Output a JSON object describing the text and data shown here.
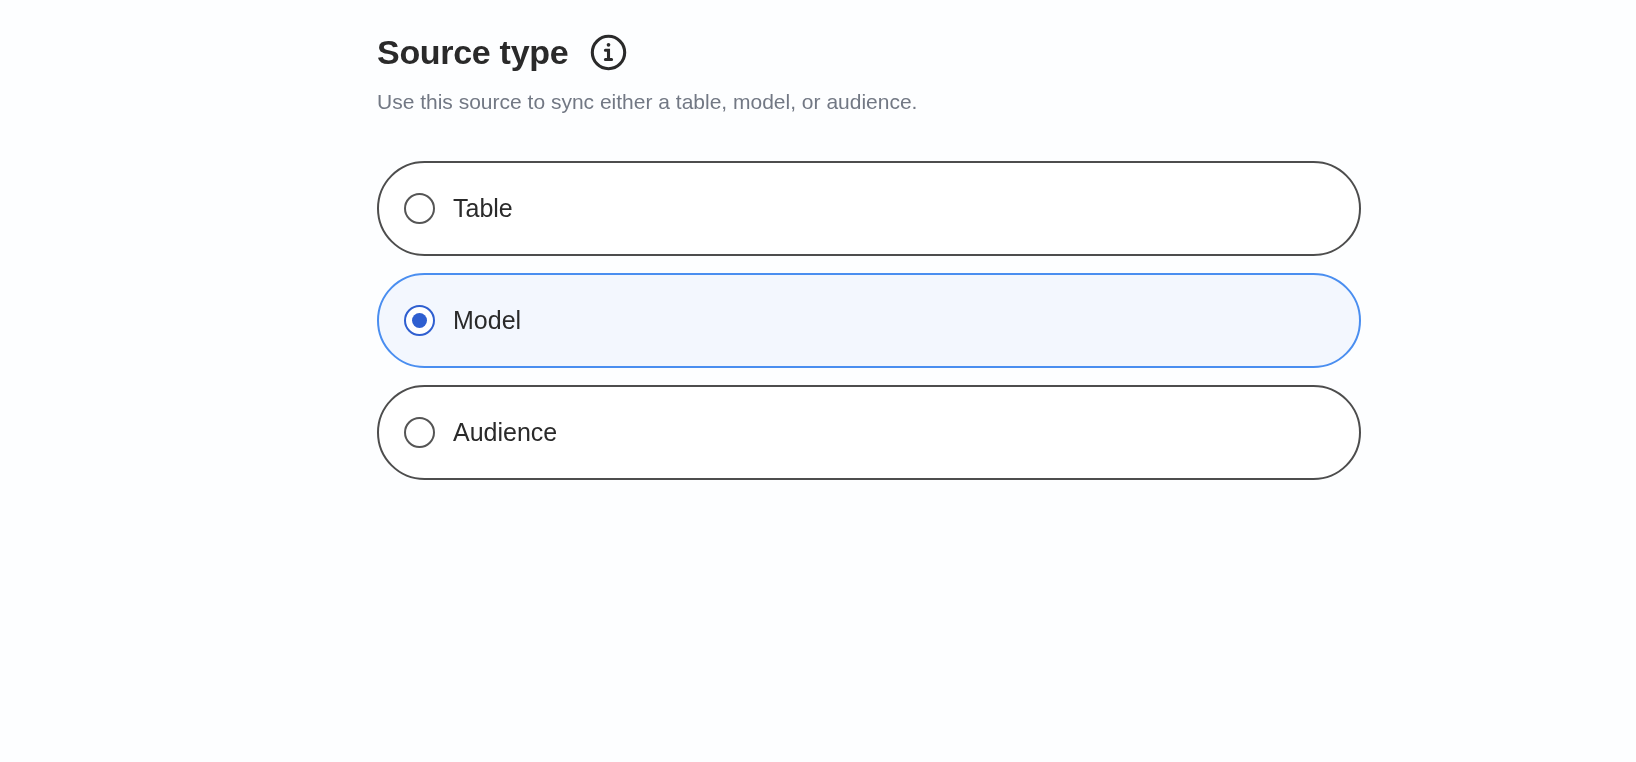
{
  "section": {
    "title": "Source type",
    "description": "Use this source to sync either a table, model, or audience."
  },
  "options": [
    {
      "label": "Table",
      "selected": false
    },
    {
      "label": "Model",
      "selected": true
    },
    {
      "label": "Audience",
      "selected": false
    }
  ]
}
